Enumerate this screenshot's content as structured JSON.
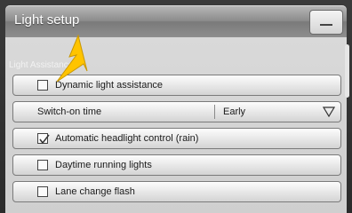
{
  "window": {
    "title": "Light setup"
  },
  "section": {
    "label": "Light Assistance"
  },
  "items": [
    {
      "type": "checkbox",
      "label": "Dynamic light assistance",
      "checked": false
    },
    {
      "type": "select",
      "label": "Switch-on time",
      "value": "Early"
    },
    {
      "type": "checkbox",
      "label": "Automatic headlight control (rain)",
      "checked": true
    },
    {
      "type": "checkbox",
      "label": "Daytime running lights",
      "checked": false
    },
    {
      "type": "checkbox",
      "label": "Lane change flash",
      "checked": false
    }
  ],
  "icons": {
    "minimize": "minimize-icon",
    "dropdown": "triangle-down-icon",
    "pointer": "pointer-arrow-icon",
    "checkmark": "checkmark-icon"
  },
  "colors": {
    "pointer": "#ffc400",
    "title": "#ffffff"
  }
}
